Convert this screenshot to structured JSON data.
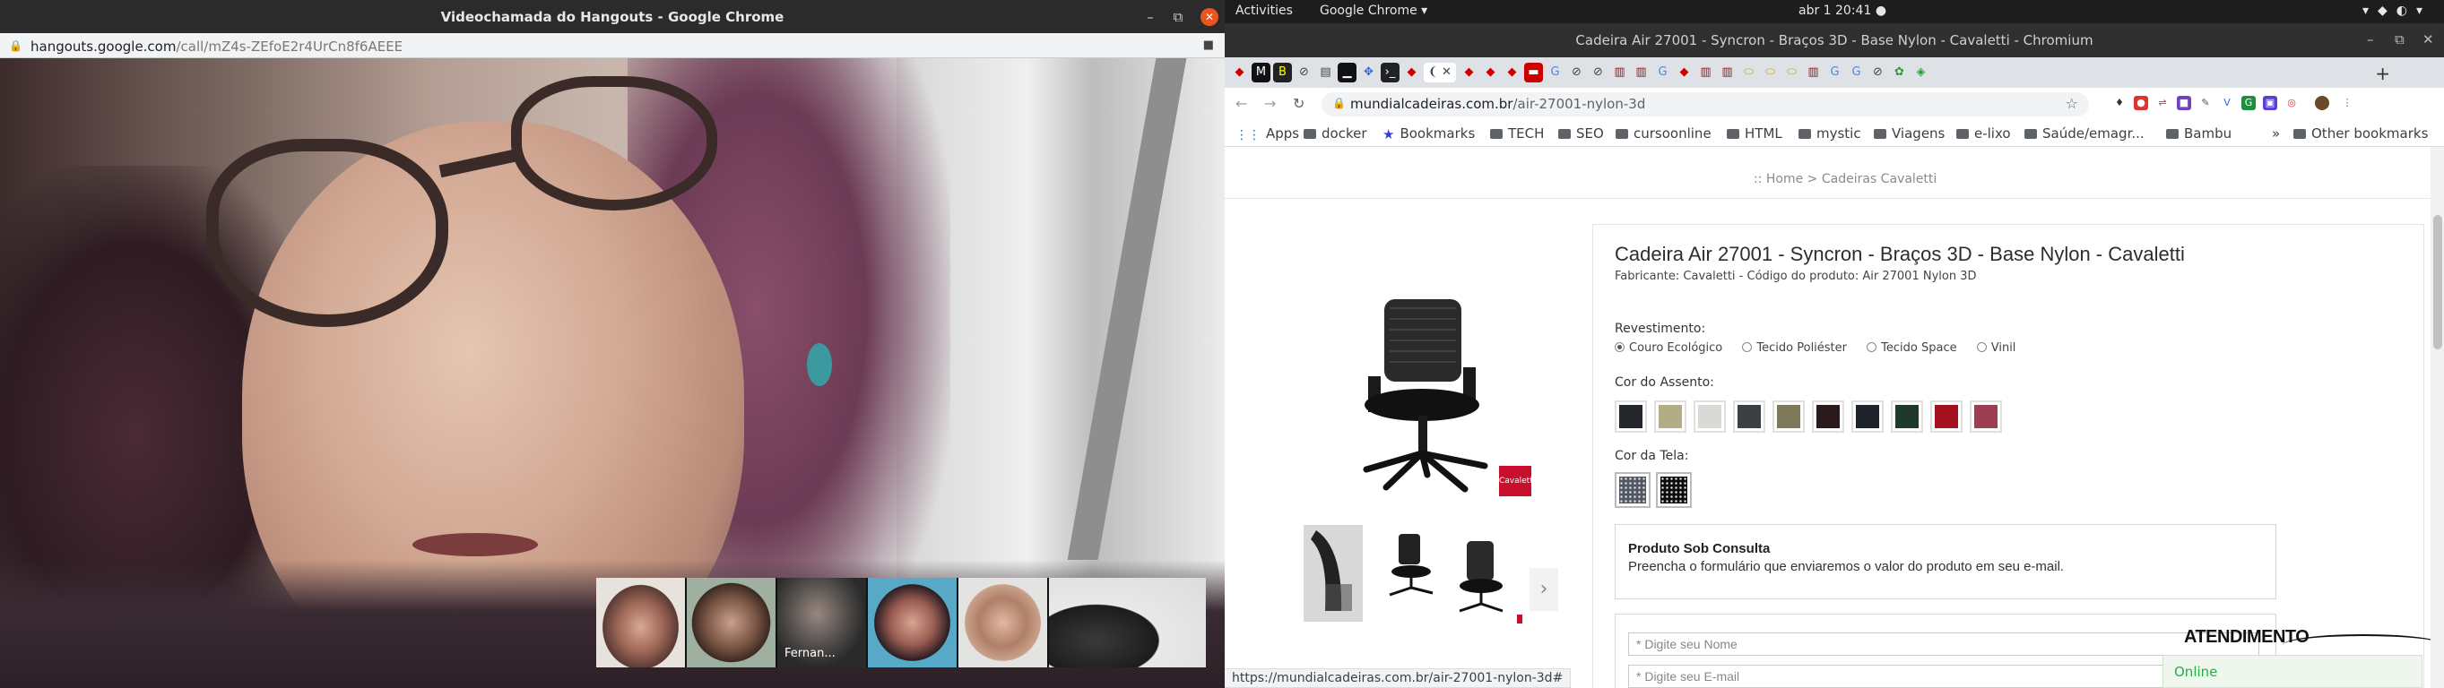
{
  "hangouts": {
    "window_title": "Videochamada do Hangouts - Google Chrome",
    "url_host": "hangouts.google.com",
    "url_path": "/call/mZ4s-ZEfoE2r4UrCn8f6AEEE",
    "thumbnail_name": "Fernan..."
  },
  "desktop": {
    "activities": "Activities",
    "app_menu": "Google Chrome ▾",
    "clock": "abr 1  20:41 ●"
  },
  "chromium": {
    "window_title": "Cadeira Air 27001 - Syncron - Braços 3D - Base Nylon - Cavaletti - Chromium",
    "url_host": "mundialcadeiras.com.br",
    "url_path": "/air-27001-nylon-3d",
    "status_url": "https://mundialcadeiras.com.br/air-27001-nylon-3d#"
  },
  "bookmarks": {
    "items": [
      "Apps",
      "docker",
      "Bookmarks",
      "TECH",
      "SEO",
      "cursoonline",
      "HTML",
      "mystic",
      "Viagens",
      "e-lixo",
      "Saúde/emagr...",
      "Bambu"
    ],
    "other": "Other bookmarks"
  },
  "product": {
    "breadcrumb": ":: Home > Cadeiras Cavaletti",
    "title": "Cadeira Air 27001 - Syncron - Braços 3D - Base Nylon - Cavaletti",
    "subtitle": "Fabricante: Cavaletti - Código do produto: Air 27001 Nylon 3D",
    "brand_badge": "Cavaletti",
    "revestimento_label": "Revestimento:",
    "revestimento_options": [
      "Couro Ecológico",
      "Tecido Poliéster",
      "Tecido Space",
      "Vinil"
    ],
    "cor_assento_label": "Cor do Assento:",
    "seat_colors": [
      "#23262b",
      "#b3ad86",
      "#d9d9d6",
      "#3c3f43",
      "#7d7a59",
      "#2a1a1c",
      "#1d2329",
      "#1f3a2a",
      "#a3101e",
      "#9c3f52"
    ],
    "cor_tela_label": "Cor da Tela:",
    "tela_colors": [
      "#525766",
      "#0c0c0e"
    ]
  },
  "consulta": {
    "title": "Produto Sob Consulta",
    "text": "Preencha o formulário que enviaremos o valor do produto em seu e-mail."
  },
  "form": {
    "name_placeholder": "* Digite seu Nome",
    "email_placeholder": "* Digite seu E-mail"
  },
  "chat": {
    "heading": "ATENDIMENTO",
    "status": "Online"
  }
}
